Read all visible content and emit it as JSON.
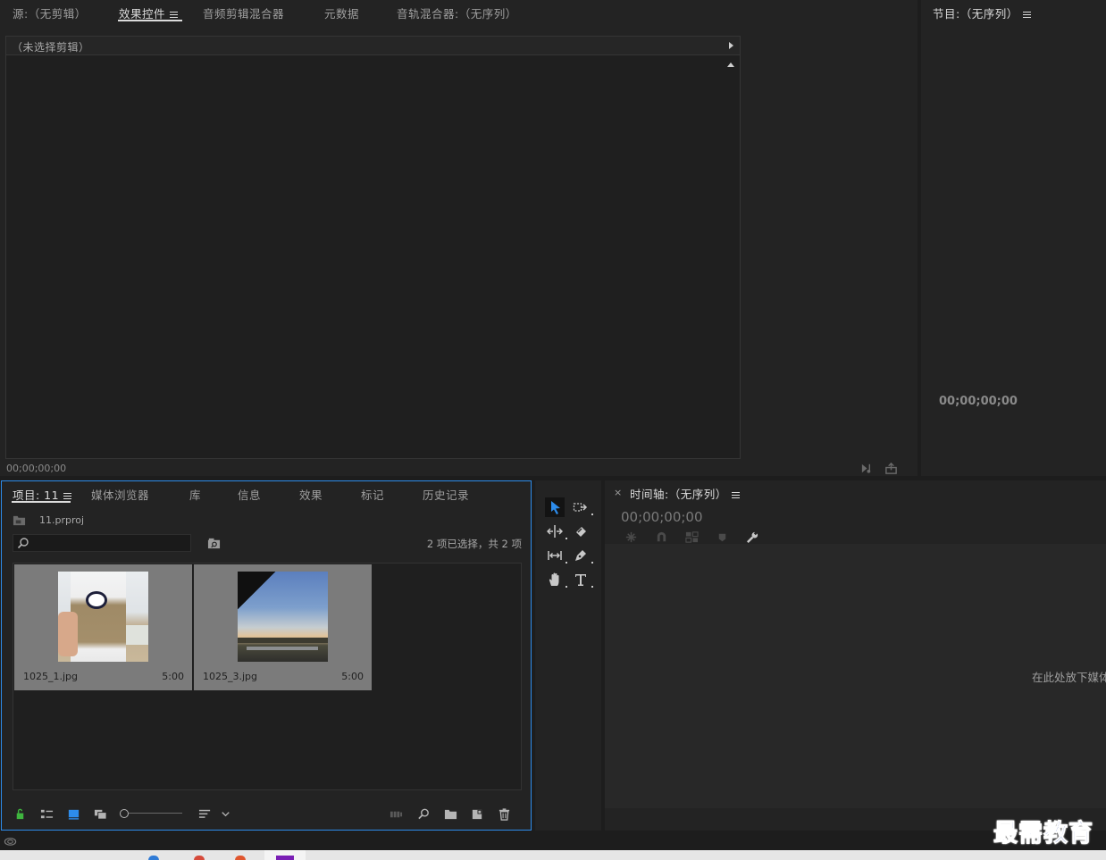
{
  "top_panel": {
    "tabs": [
      {
        "label": "源:（无剪辑）"
      },
      {
        "label": "效果控件"
      },
      {
        "label": "音频剪辑混合器"
      },
      {
        "label": "元数据"
      },
      {
        "label": "音轨混合器:（无序列）"
      }
    ],
    "no_clip_label": "（未选择剪辑）",
    "timecode": "00;00;00;00"
  },
  "program_panel": {
    "title": "节目:（无序列）",
    "timecode": "00;00;00;00"
  },
  "project_panel": {
    "tabs": [
      {
        "label": "项目: 11"
      },
      {
        "label": "媒体浏览器"
      },
      {
        "label": "库"
      },
      {
        "label": "信息"
      },
      {
        "label": "效果"
      },
      {
        "label": "标记"
      },
      {
        "label": "历史记录"
      }
    ],
    "file_name": "11.prproj",
    "search_value": "",
    "selection_status": "2 项已选择，共 2 项",
    "items": [
      {
        "name": "1025_1.jpg",
        "duration": "5:00"
      },
      {
        "name": "1025_3.jpg",
        "duration": "5:00"
      }
    ]
  },
  "timeline_panel": {
    "close_label": "×",
    "title": "时间轴:（无序列）",
    "timecode": "00;00;00;00",
    "drop_hint": "在此处放下媒体"
  },
  "watermark": {
    "text": "最需教育"
  },
  "colors": {
    "accent": "#2d8ceb",
    "panel_bg": "#232323",
    "app_bg": "#1d1d1d",
    "watermark_fill": "#1a3fb0"
  }
}
